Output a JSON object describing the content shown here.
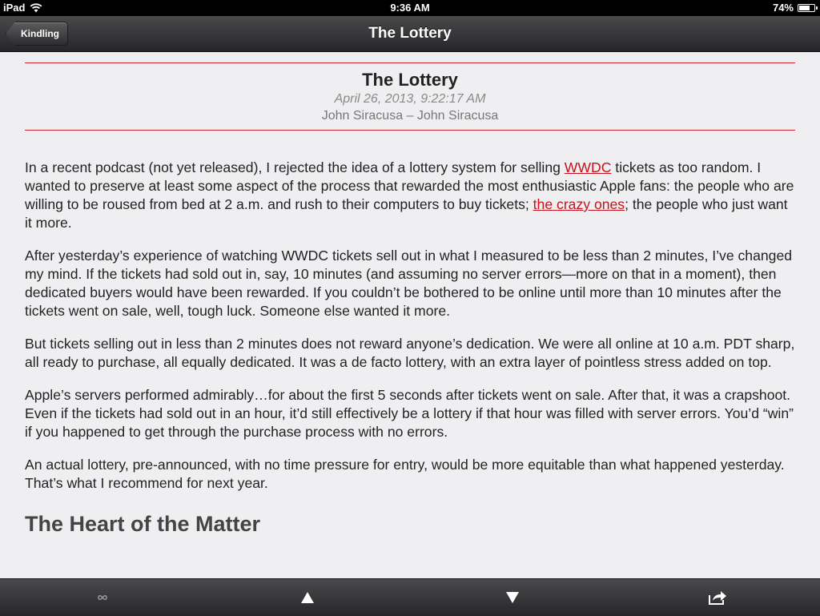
{
  "status_bar": {
    "device": "iPad",
    "time": "9:36 AM",
    "battery_text": "74%",
    "battery_level": 0.74
  },
  "nav": {
    "back_label": "Kindling",
    "title": "The Lottery"
  },
  "article": {
    "title": "The Lottery",
    "date": "April 26, 2013, 9:22:17 AM",
    "author": "John Siracusa – John Siracusa",
    "p1": {
      "t1": "In a recent podcast (not yet released), I rejected the idea of a lottery system for selling ",
      "link1": "WWDC",
      "t2": " tickets as too random. I wanted to preserve at least some aspect of the process that rewarded the most enthusiastic Apple fans: the people who are willing to be roused from bed at 2 a.m. and rush to their computers to buy tickets; ",
      "link2": "the crazy ones",
      "t3": "; the people who just want it more."
    },
    "p2": "After yesterday’s experience of watching WWDC tickets sell out in what I measured to be less than 2 minutes, I’ve changed my mind. If the tickets had sold out in, say, 10 minutes (and assuming no server errors—more on that in a moment), then dedicated buyers would have been rewarded. If you couldn’t be bothered to be online until more than 10 minutes after the tickets went on sale, well, tough luck. Someone else wanted it more.",
    "p3": "But tickets selling out in less than 2 minutes does not reward anyone’s dedication. We were all online at 10 a.m. PDT sharp, all ready to purchase, all equally dedicated. It was a de facto lottery, with an extra layer of pointless stress added on top.",
    "p4": "Apple’s servers performed admirably…for about the first 5 seconds after tickets went on sale. After that, it was a crapshoot. Even if the tickets had sold out in an hour, it’d still effectively be a lottery if that hour was filled with server errors. You’d “win” if you happened to get through the purchase process with no errors.",
    "p5": "An actual lottery, pre-announced, with no time pressure for entry, would be more equitable than what happened yesterday. That’s what I recommend for next year.",
    "subhead": "The Heart of the Matter"
  },
  "colors": {
    "accent": "#c8101e",
    "rule": "#c8262e",
    "background": "#efeff1"
  },
  "icons": {
    "status_wifi": "wifi-icon",
    "status_battery": "battery-icon",
    "tool_1": "infinity-icon",
    "tool_2": "triangle-up-icon",
    "tool_3": "triangle-down-icon",
    "tool_4": "share-icon"
  }
}
